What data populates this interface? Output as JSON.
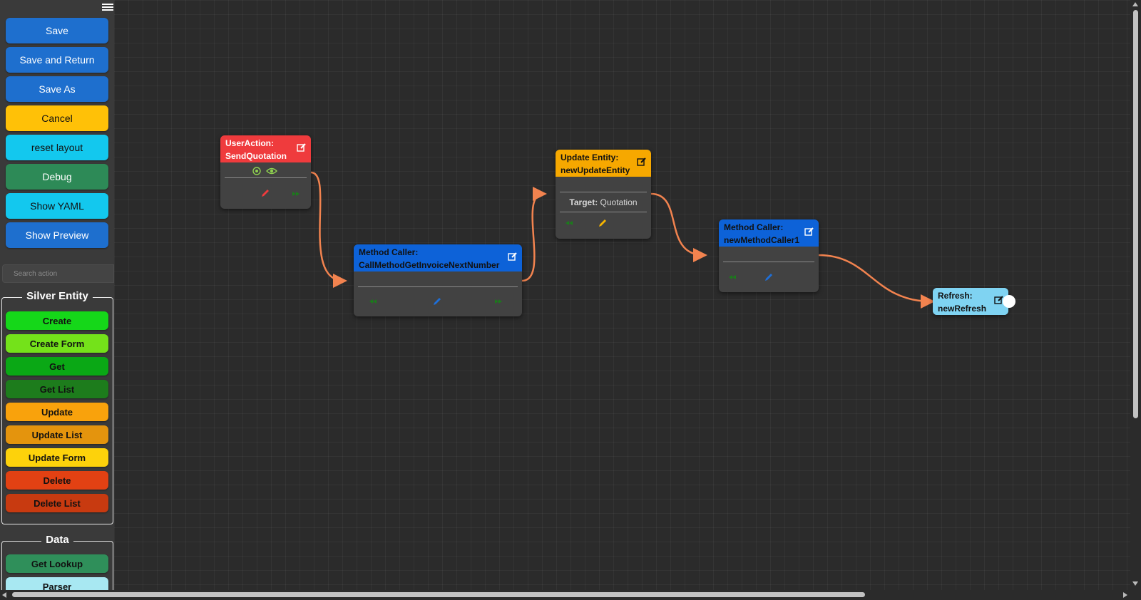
{
  "toolbar": {
    "save": "Save",
    "save_and_return": "Save and Return",
    "save_as": "Save As",
    "cancel": "Cancel",
    "reset_layout": "reset layout",
    "debug": "Debug",
    "show_yaml": "Show YAML",
    "show_preview": "Show Preview"
  },
  "search": {
    "placeholder": "Search action"
  },
  "groups": {
    "silver_entity": {
      "title": "Silver Entity",
      "actions": [
        "Create",
        "Create Form",
        "Get",
        "Get List",
        "Update",
        "Update List",
        "Update Form",
        "Delete",
        "Delete List"
      ]
    },
    "data": {
      "title": "Data",
      "actions": [
        "Get Lookup",
        "Parser"
      ]
    }
  },
  "nodes": {
    "user_action": {
      "line1": "UserAction:",
      "line2": "SendQuotation"
    },
    "method_caller_1": {
      "line1": "Method Caller:",
      "line2": "CallMethodGetInvoiceNextNumber"
    },
    "update_entity": {
      "line1": "Update Entity:",
      "line2": "newUpdateEntity",
      "target_label": "Target:",
      "target_value": "Quotation"
    },
    "method_caller_2": {
      "line1": "Method Caller:",
      "line2": "newMethodCaller1"
    },
    "refresh": {
      "line1": "Refresh:",
      "line2": "newRefresh"
    }
  },
  "icons": {
    "menu": "hamburger-icon",
    "edit": "edit-icon",
    "pencil": "pencil-icon",
    "port_in": "arrow-in-icon",
    "port_out": "arrow-out-icon",
    "target": "target-icon",
    "eye": "eye-icon"
  },
  "colors": {
    "primary": "#1e6fce",
    "warning": "#ffc107",
    "info": "#13c8ee",
    "debug": "#2d8a57",
    "user_action": "#ef3b3d",
    "method_caller": "#0d62d8",
    "update_entity": "#f6a800",
    "refresh": "#7fd3f2",
    "edge": "#f2834f",
    "create": "#15d719",
    "create_form": "#74e21a",
    "get": "#0aa815",
    "get_list": "#1d7c1c",
    "update": "#f9a20c",
    "update_list": "#e4940d",
    "update_form": "#fdd20b",
    "delete": "#e24113",
    "delete_list": "#c83a10",
    "get_lookup": "#2f8f5a",
    "parser": "#a8e8f2"
  }
}
